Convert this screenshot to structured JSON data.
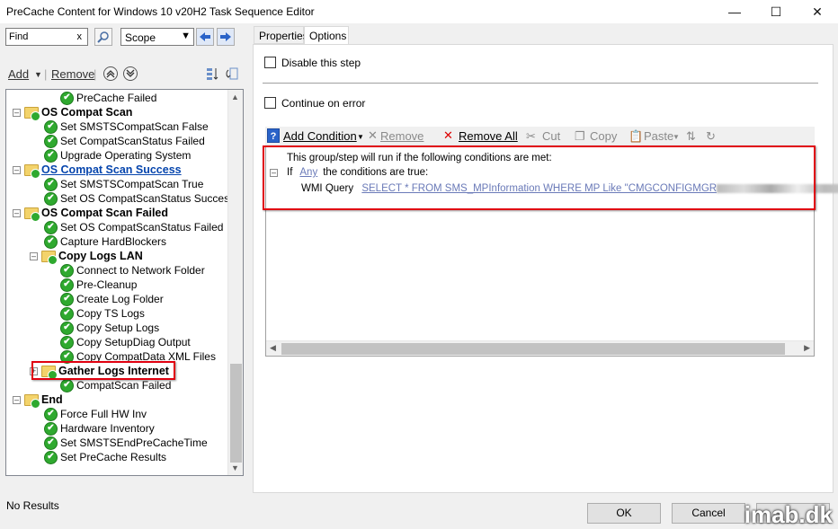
{
  "window": {
    "title": "PreCache Content for Windows 10 v20H2 Task Sequence Editor",
    "minimize_icon": "minimize-icon",
    "maximize_icon": "maximize-icon",
    "close_icon": "close-icon"
  },
  "find": {
    "value": "Find",
    "clear_label": "x",
    "scope_value": "Scope"
  },
  "left_toolbar": {
    "add_label": "Add",
    "remove_label": "Remove"
  },
  "tree": {
    "items": [
      {
        "label": "PreCache Failed",
        "type": "step"
      },
      {
        "label": "OS Compat Scan",
        "type": "group"
      },
      {
        "label": "Set SMSTSCompatScan False",
        "type": "step"
      },
      {
        "label": "Set CompatScanStatus Failed",
        "type": "step"
      },
      {
        "label": "Upgrade Operating System",
        "type": "step"
      },
      {
        "label": "OS Compat Scan Success",
        "type": "group"
      },
      {
        "label": "Set SMSTSCompatScan True",
        "type": "step"
      },
      {
        "label": "Set OS CompatScanStatus Success",
        "type": "step"
      },
      {
        "label": "OS Compat Scan Failed",
        "type": "group"
      },
      {
        "label": "Set OS CompatScanStatus Failed",
        "type": "step"
      },
      {
        "label": "Capture HardBlockers",
        "type": "step"
      },
      {
        "label": "Copy Logs LAN",
        "type": "group"
      },
      {
        "label": "Connect to Network Folder",
        "type": "step"
      },
      {
        "label": "Pre-Cleanup",
        "type": "step"
      },
      {
        "label": "Create Log Folder",
        "type": "step"
      },
      {
        "label": "Copy TS Logs",
        "type": "step"
      },
      {
        "label": "Copy Setup Logs",
        "type": "step"
      },
      {
        "label": "Copy SetupDiag Output",
        "type": "step"
      },
      {
        "label": "Copy CompatData XML Files",
        "type": "step"
      },
      {
        "label": "Gather Logs Internet",
        "type": "group"
      },
      {
        "label": "CompatScan Failed",
        "type": "step"
      },
      {
        "label": "End",
        "type": "group"
      },
      {
        "label": "Force Full HW Inv",
        "type": "step"
      },
      {
        "label": "Hardware Inventory",
        "type": "step"
      },
      {
        "label": "Set SMSTSEndPreCacheTime",
        "type": "step"
      },
      {
        "label": "Set PreCache Results",
        "type": "step"
      }
    ]
  },
  "status": "No Results",
  "tabs": [
    "Properties",
    "Options"
  ],
  "options": {
    "disable_label": "Disable this step",
    "continue_label": "Continue on error"
  },
  "cond_toolbar": {
    "add_condition": "Add Condition",
    "remove": "Remove",
    "remove_all": "Remove All",
    "cut": "Cut",
    "copy": "Copy",
    "paste": "Paste"
  },
  "conditions": {
    "intro": "This group/step will run if the following conditions are met:",
    "if_word": "If",
    "any_word": "Any",
    "are_true": "the conditions are true:",
    "wmi_label": "WMI Query",
    "wmi_query": "SELECT * FROM SMS_MPInformation WHERE MP Like \"CMGCONFIGMGR"
  },
  "buttons": {
    "ok": "OK",
    "cancel": "Cancel"
  },
  "watermark": "imab.dk",
  "colors": {
    "highlight_red": "#e0000f",
    "link_blue": "#0645ad",
    "success_green": "#2fa92f"
  }
}
